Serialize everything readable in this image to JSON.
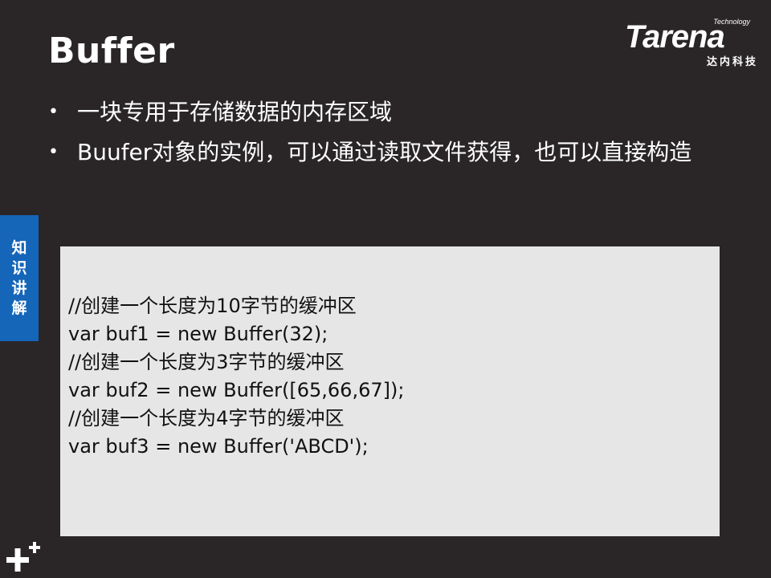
{
  "slide": {
    "title": "Buffer",
    "logo": {
      "tagline": "Technology",
      "wordmark": "Tarena",
      "subtitle": "达内科技"
    },
    "bullets": [
      {
        "marker": "•",
        "text": "一块专用于存储数据的内存区域"
      },
      {
        "marker": "•",
        "text": "Buufer对象的实例，可以通过读取文件获得，也可以直接构造"
      }
    ],
    "side_tab": {
      "label": "知识讲解"
    },
    "code_lines": [
      "//创建一个长度为10字节的缓冲区",
      "var buf1 = new Buffer(32);",
      "//创建一个长度为3字节的缓冲区",
      "var buf2 = new Buffer([65,66,67]);",
      "//创建一个长度为4字节的缓冲区",
      "var buf3 = new Buffer('ABCD');"
    ],
    "colors": {
      "background": "#2a2627",
      "side_tab": "#1565b8",
      "code_box": "#e6e6e6",
      "text": "#ffffff"
    },
    "icons": {
      "corner": "plus-icon"
    }
  }
}
